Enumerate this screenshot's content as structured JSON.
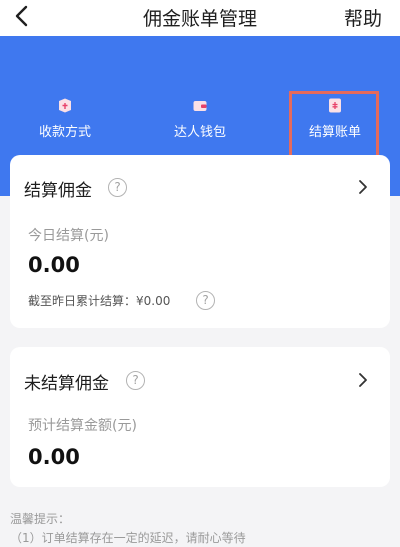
{
  "header": {
    "title": "佣金账单管理",
    "help_label": "帮助"
  },
  "banner": {
    "entries": [
      {
        "label": "收款方式",
        "icon": "payment-box-icon"
      },
      {
        "label": "达人钱包",
        "icon": "wallet-icon"
      },
      {
        "label": "结算账单",
        "icon": "bill-icon"
      }
    ],
    "colors": {
      "background": "#3f78ef",
      "highlight": "#e56a5c"
    }
  },
  "settled": {
    "title": "结算佣金",
    "today_label": "今日结算(元)",
    "today_amount": "0.00",
    "cumulative": "截至昨日累计结算：¥0.00"
  },
  "unsettled": {
    "title": "未结算佣金",
    "estimated_label": "预计结算金额(元)",
    "estimated_amount": "0.00"
  },
  "tips": {
    "title": "温馨提示：",
    "line1": "（1）订单结算存在一定的延迟，请耐心等待"
  }
}
